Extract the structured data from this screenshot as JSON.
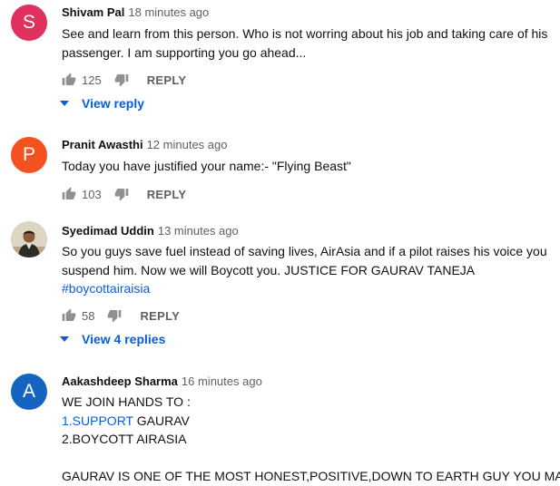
{
  "comments": [
    {
      "author": "Shivam Pal",
      "time": "18 minutes ago",
      "avatar_letter": "S",
      "avatar_color": "#e0305d",
      "lines": [
        "See and learn from this person. Who is not worring about his job and  taking care of his",
        "passenger. I am supporting you go ahead..."
      ],
      "likes": "125",
      "reply_label": "REPLY",
      "view_replies": "View reply"
    },
    {
      "author": "Pranit Awasthi",
      "time": "12 minutes ago",
      "avatar_letter": "P",
      "avatar_color": "#f4511e",
      "lines": [
        "Today you have justified your name:- \"Flying Beast\""
      ],
      "likes": "103",
      "reply_label": "REPLY"
    },
    {
      "author": "Syedimad Uddin",
      "time": "13 minutes ago",
      "lines": [
        "So you guys save fuel instead of saving lives, AirAsia and if a pilot raises his voice you",
        "suspend him. Now we will Boycott you.  JUSTICE FOR GAURAV TANEJA"
      ],
      "hashtag": "#boycottairaisia",
      "likes": "58",
      "reply_label": "REPLY",
      "view_replies": "View 4 replies"
    },
    {
      "author": "Aakashdeep Sharma",
      "time": "16 minutes ago",
      "avatar_letter": "A",
      "avatar_color": "#1565c0",
      "line1": "WE JOIN HANDS TO :",
      "line2_link": "1.SUPPORT",
      "line2_rest": " GAURAV",
      "line3": "2.BOYCOTT AIRASIA",
      "line5": "GAURAV IS ONE OF THE MOST HONEST,POSITIVE,DOWN TO EARTH GUY YOU MAY"
    }
  ],
  "colors": {
    "link": "#065fd4",
    "secondary_text": "#606060",
    "icon": "#909090"
  }
}
